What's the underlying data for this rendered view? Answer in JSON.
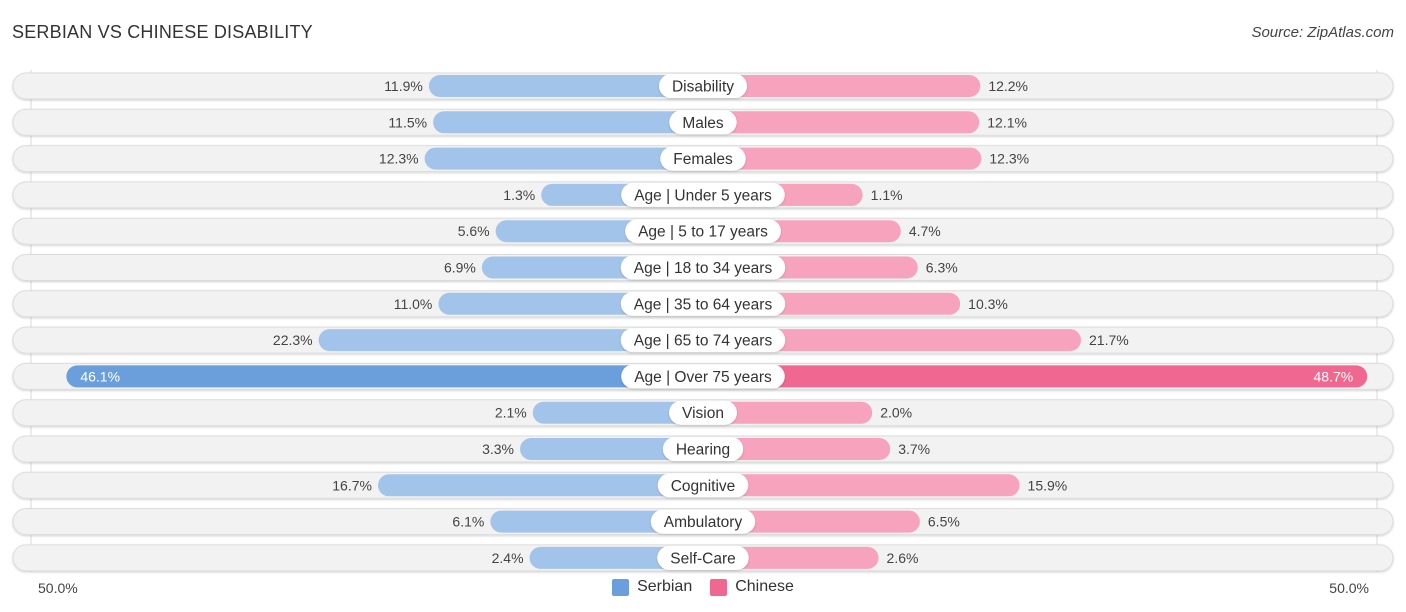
{
  "header": {
    "title": "SERBIAN VS CHINESE DISABILITY",
    "source": "Source: ZipAtlas.com"
  },
  "axis": {
    "left_label": "50.0%",
    "right_label": "50.0%"
  },
  "legend": [
    {
      "name": "Serbian",
      "color": "#6a9fdb"
    },
    {
      "name": "Chinese",
      "color": "#f06892"
    }
  ],
  "colors": {
    "serbian_bar": "#a3c4ea",
    "serbian_bar_strong": "#6a9fdb",
    "chinese_bar": "#f7a3bd",
    "chinese_bar_strong": "#f06892",
    "track": "#f2f2f2"
  },
  "chart_data": {
    "type": "bar",
    "orientation": "horizontal-diverging",
    "title": "SERBIAN VS CHINESE DISABILITY",
    "xlabel": "",
    "ylabel": "",
    "xlim": [
      -50,
      50
    ],
    "tick_labels": [
      "50.0%",
      "50.0%"
    ],
    "legend_position": "bottom-center",
    "categories": [
      "Disability",
      "Males",
      "Females",
      "Age | Under 5 years",
      "Age | 5 to 17 years",
      "Age | 18 to 34 years",
      "Age | 35 to 64 years",
      "Age | 65 to 74 years",
      "Age | Over 75 years",
      "Vision",
      "Hearing",
      "Cognitive",
      "Ambulatory",
      "Self-Care"
    ],
    "series": [
      {
        "name": "Serbian",
        "side": "left",
        "values": [
          11.9,
          11.5,
          12.3,
          1.3,
          5.6,
          6.9,
          11.0,
          22.3,
          46.1,
          2.1,
          3.3,
          16.7,
          6.1,
          2.4
        ],
        "labels": [
          "11.9%",
          "11.5%",
          "12.3%",
          "1.3%",
          "5.6%",
          "6.9%",
          "11.0%",
          "22.3%",
          "46.1%",
          "2.1%",
          "3.3%",
          "16.7%",
          "6.1%",
          "2.4%"
        ]
      },
      {
        "name": "Chinese",
        "side": "right",
        "values": [
          12.2,
          12.1,
          12.3,
          1.1,
          4.7,
          6.3,
          10.3,
          21.7,
          48.7,
          2.0,
          3.7,
          15.9,
          6.5,
          2.6
        ],
        "labels": [
          "12.2%",
          "12.1%",
          "12.3%",
          "1.1%",
          "4.7%",
          "6.3%",
          "10.3%",
          "21.7%",
          "48.7%",
          "2.0%",
          "3.7%",
          "15.9%",
          "6.5%",
          "2.6%"
        ]
      }
    ],
    "highlighted_category": "Age | Over 75 years"
  }
}
